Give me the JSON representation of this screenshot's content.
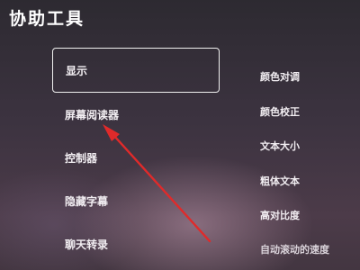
{
  "page": {
    "title": "协助工具"
  },
  "left_menu": {
    "items": [
      {
        "label": "显示",
        "selected": true
      },
      {
        "label": "屏幕阅读器",
        "selected": false
      },
      {
        "label": "控制器",
        "selected": false
      },
      {
        "label": "隐藏字幕",
        "selected": false
      },
      {
        "label": "聊天转录",
        "selected": false
      }
    ]
  },
  "right_menu": {
    "items": [
      {
        "label": "颜色对调"
      },
      {
        "label": "颜色校正"
      },
      {
        "label": "文本大小"
      },
      {
        "label": "粗体文本"
      },
      {
        "label": "高对比度"
      },
      {
        "label": "自动滚动的速度"
      }
    ]
  },
  "annotation": {
    "arrow_color": "#e02a2a",
    "points_to": "屏幕阅读器"
  }
}
